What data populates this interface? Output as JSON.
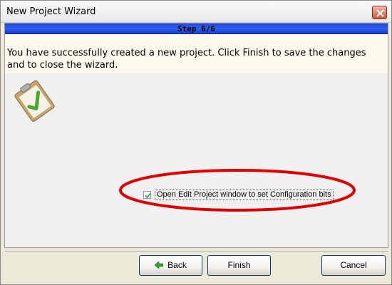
{
  "window": {
    "title": "New Project Wizard"
  },
  "step": {
    "label": "Step 6/6"
  },
  "message": {
    "text": "You have successfully created a new project. Click Finish to save the changes and to close the wizard."
  },
  "options": {
    "open_edit_project": {
      "label": "Open Edit Project window to set Configuration bits",
      "checked": true
    }
  },
  "buttons": {
    "back_label": "Back",
    "finish_label": "Finish",
    "cancel_label": "Cancel"
  },
  "icons": {
    "success": "clipboard-check-icon",
    "back": "green-left-arrow-icon",
    "close": "close-x-icon"
  },
  "colors": {
    "step_bar": "#2d62f0",
    "highlight": "#e00000",
    "check": "#4aa832"
  }
}
